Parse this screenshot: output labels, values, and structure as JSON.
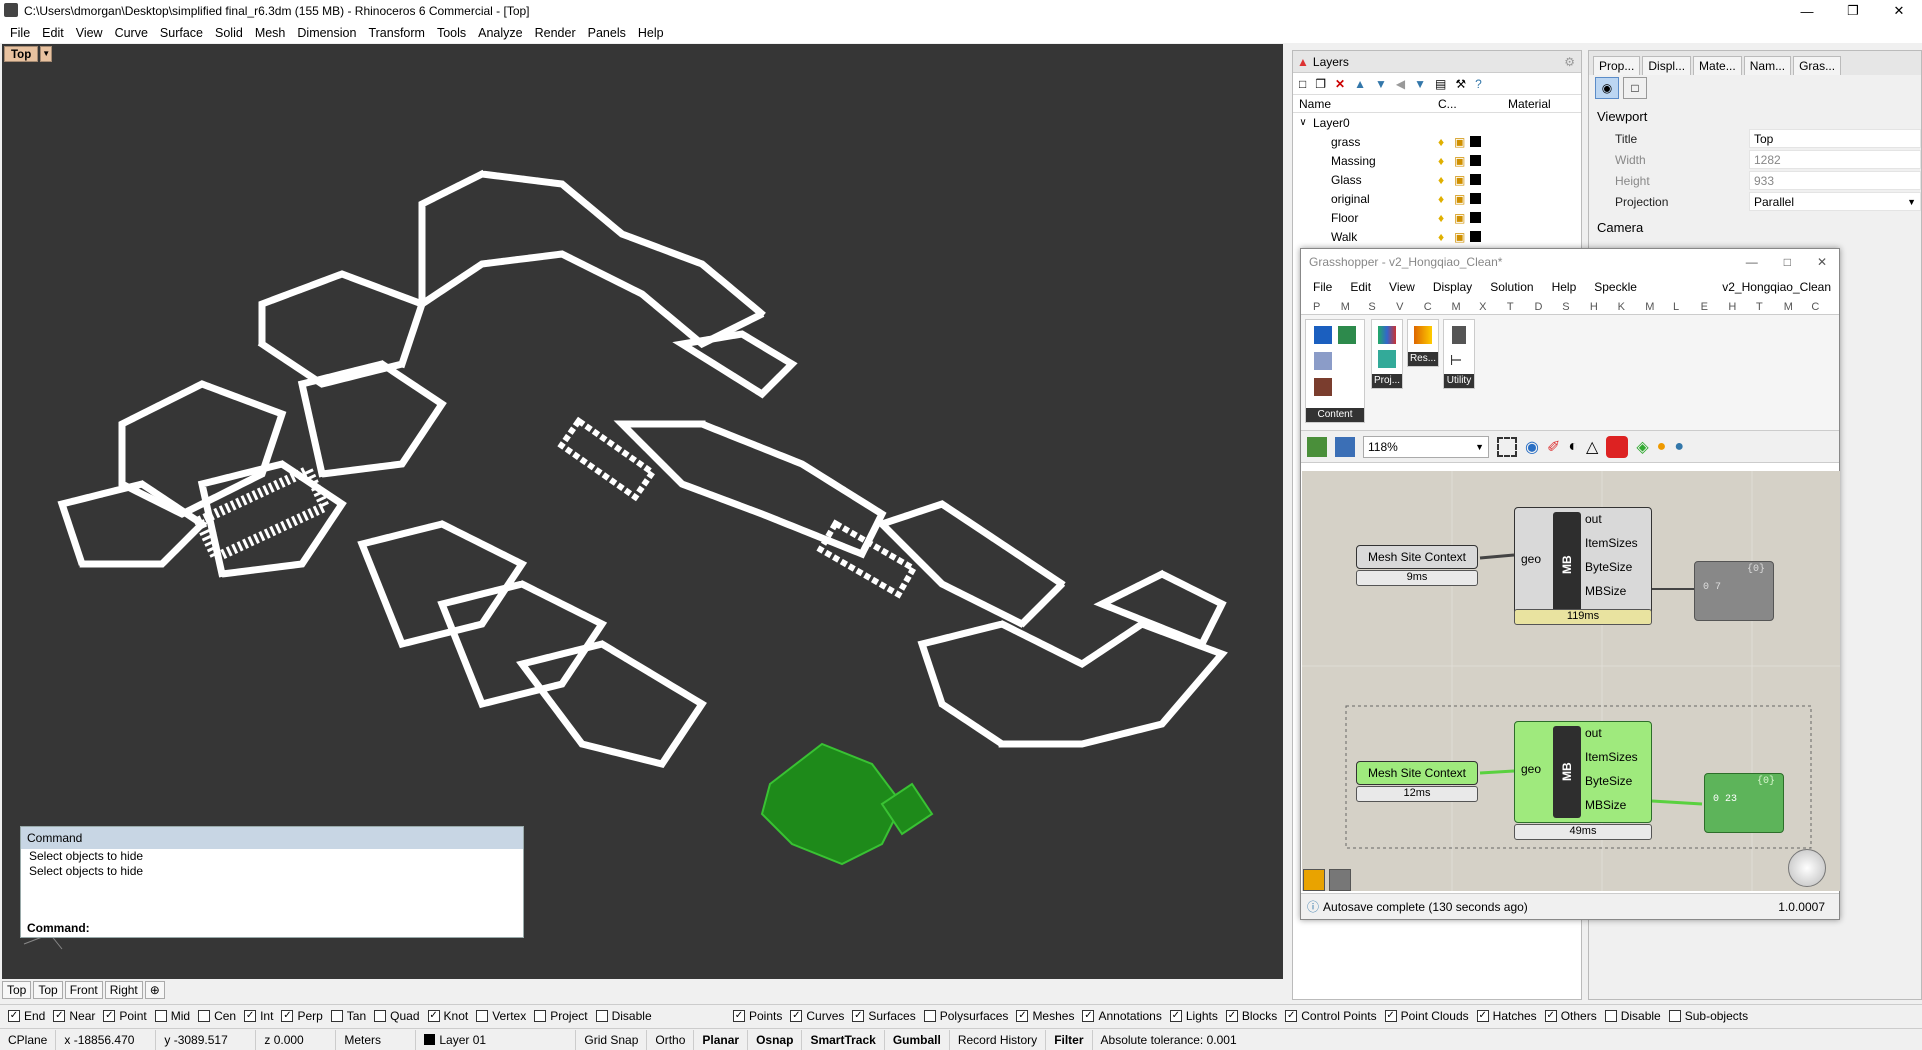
{
  "window": {
    "title": "C:\\Users\\dmorgan\\Desktop\\simplified final_r6.3dm (155 MB) - Rhinoceros 6 Commercial - [Top]"
  },
  "menu": [
    "File",
    "Edit",
    "View",
    "Curve",
    "Surface",
    "Solid",
    "Mesh",
    "Dimension",
    "Transform",
    "Tools",
    "Analyze",
    "Render",
    "Panels",
    "Help"
  ],
  "viewport": {
    "name": "Top"
  },
  "command": {
    "header": "Command",
    "lines": [
      "Select objects to hide",
      "Select objects to hide"
    ],
    "prompt": "Command:"
  },
  "viewport_tabs": [
    "Top",
    "Top",
    "Front",
    "Right"
  ],
  "osnap": [
    {
      "label": "End",
      "on": true
    },
    {
      "label": "Near",
      "on": true
    },
    {
      "label": "Point",
      "on": true
    },
    {
      "label": "Mid",
      "on": false
    },
    {
      "label": "Cen",
      "on": false
    },
    {
      "label": "Int",
      "on": true
    },
    {
      "label": "Perp",
      "on": true
    },
    {
      "label": "Tan",
      "on": false
    },
    {
      "label": "Quad",
      "on": false
    },
    {
      "label": "Knot",
      "on": true
    },
    {
      "label": "Vertex",
      "on": false
    },
    {
      "label": "Project",
      "on": false
    },
    {
      "label": "Disable",
      "on": false
    }
  ],
  "filters": [
    {
      "label": "Points",
      "on": true
    },
    {
      "label": "Curves",
      "on": true
    },
    {
      "label": "Surfaces",
      "on": true
    },
    {
      "label": "Polysurfaces",
      "on": false
    },
    {
      "label": "Meshes",
      "on": true
    },
    {
      "label": "Annotations",
      "on": true
    },
    {
      "label": "Lights",
      "on": true
    },
    {
      "label": "Blocks",
      "on": true
    },
    {
      "label": "Control Points",
      "on": true
    },
    {
      "label": "Point Clouds",
      "on": true
    },
    {
      "label": "Hatches",
      "on": true
    },
    {
      "label": "Others",
      "on": true
    },
    {
      "label": "Disable",
      "on": false
    },
    {
      "label": "Sub-objects",
      "on": false
    }
  ],
  "status": {
    "cplane": "CPlane",
    "x": "x -18856.470",
    "y": "y -3089.517",
    "z": "z 0.000",
    "units": "Meters",
    "layer": "Layer 01",
    "toggles": [
      "Grid Snap",
      "Ortho",
      "Planar",
      "Osnap",
      "SmartTrack",
      "Gumball",
      "Record History",
      "Filter"
    ],
    "tolerance": "Absolute tolerance: 0.001"
  },
  "layers": {
    "tab": "Layers",
    "cols": [
      "Name",
      "C...",
      "Material"
    ],
    "root": "Layer0",
    "items": [
      "grass",
      "Massing",
      "Glass",
      "original",
      "Floor",
      "Walk"
    ]
  },
  "props": {
    "tabs": [
      "Prop...",
      "Displ...",
      "Mate...",
      "Nam...",
      "Gras..."
    ],
    "section_viewport": "Viewport",
    "section_camera": "Camera",
    "rows": [
      {
        "k": "Title",
        "v": "Top"
      },
      {
        "k": "Width",
        "v": "1282"
      },
      {
        "k": "Height",
        "v": "933"
      },
      {
        "k": "Projection",
        "v": "Parallel"
      }
    ]
  },
  "gh": {
    "title": "Grasshopper - v2_Hongqiao_Clean*",
    "menu": [
      "File",
      "Edit",
      "View",
      "Display",
      "Solution",
      "Help",
      "Speckle"
    ],
    "doc": "v2_Hongqiao_Clean",
    "tabs": [
      "P",
      "M",
      "S",
      "V",
      "C",
      "M",
      "X",
      "T",
      "D",
      "S",
      "H",
      "K",
      "M",
      "L",
      "E",
      "H",
      "T",
      "M",
      "C"
    ],
    "ribbon_groups": [
      "Content",
      "Proj...",
      "Res...",
      "Utility"
    ],
    "zoom": "118%",
    "node1": {
      "input": "Mesh Site Context",
      "time_in": "9ms",
      "geo": "geo",
      "mb": "MB",
      "outs": [
        "out",
        "ItemSizes",
        "ByteSize",
        "MBSize"
      ],
      "time": "119ms",
      "panel_idx": "{0}",
      "panel_val": "0 7"
    },
    "node2": {
      "input": "Mesh Site Context",
      "time_in": "12ms",
      "geo": "geo",
      "mb": "MB",
      "outs": [
        "out",
        "ItemSizes",
        "ByteSize",
        "MBSize"
      ],
      "time": "49ms",
      "panel_idx": "{0}",
      "panel_val": "0 23"
    },
    "footer": "Autosave complete (130 seconds ago)",
    "version": "1.0.0007"
  }
}
